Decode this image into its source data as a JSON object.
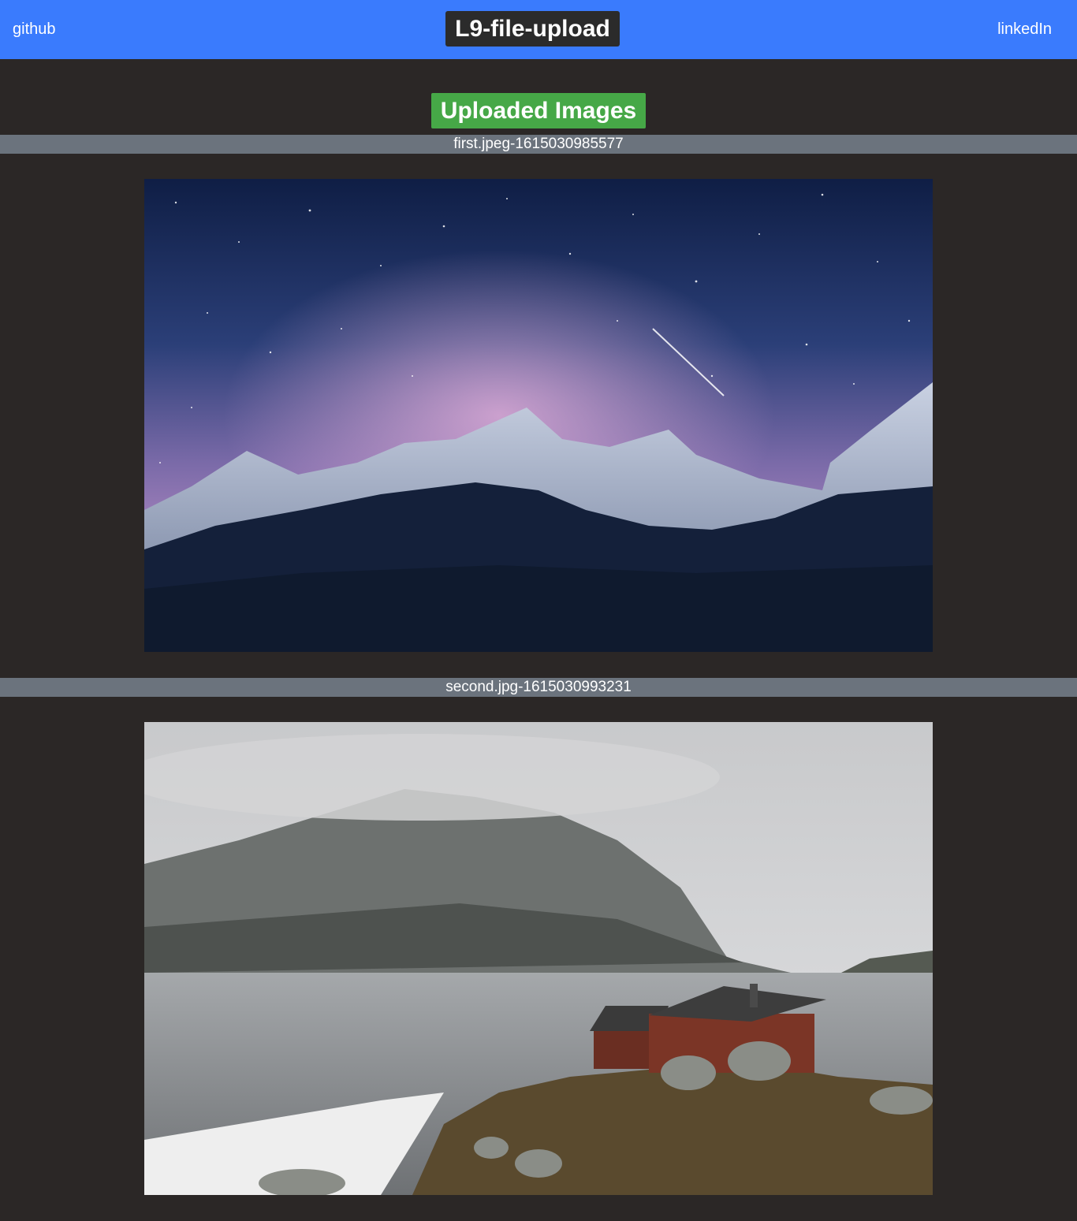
{
  "navbar": {
    "left_link": "github",
    "brand": "L9-file-upload",
    "right_link": "linkedIn",
    "color": "#3a7bfd"
  },
  "section": {
    "title": "Uploaded Images",
    "title_color": "#46a847"
  },
  "images": [
    {
      "filename": "first.jpeg-1615030985577",
      "scene": "starry-mountains"
    },
    {
      "filename": "second.jpg-1615030993231",
      "scene": "lake-cabin"
    }
  ]
}
